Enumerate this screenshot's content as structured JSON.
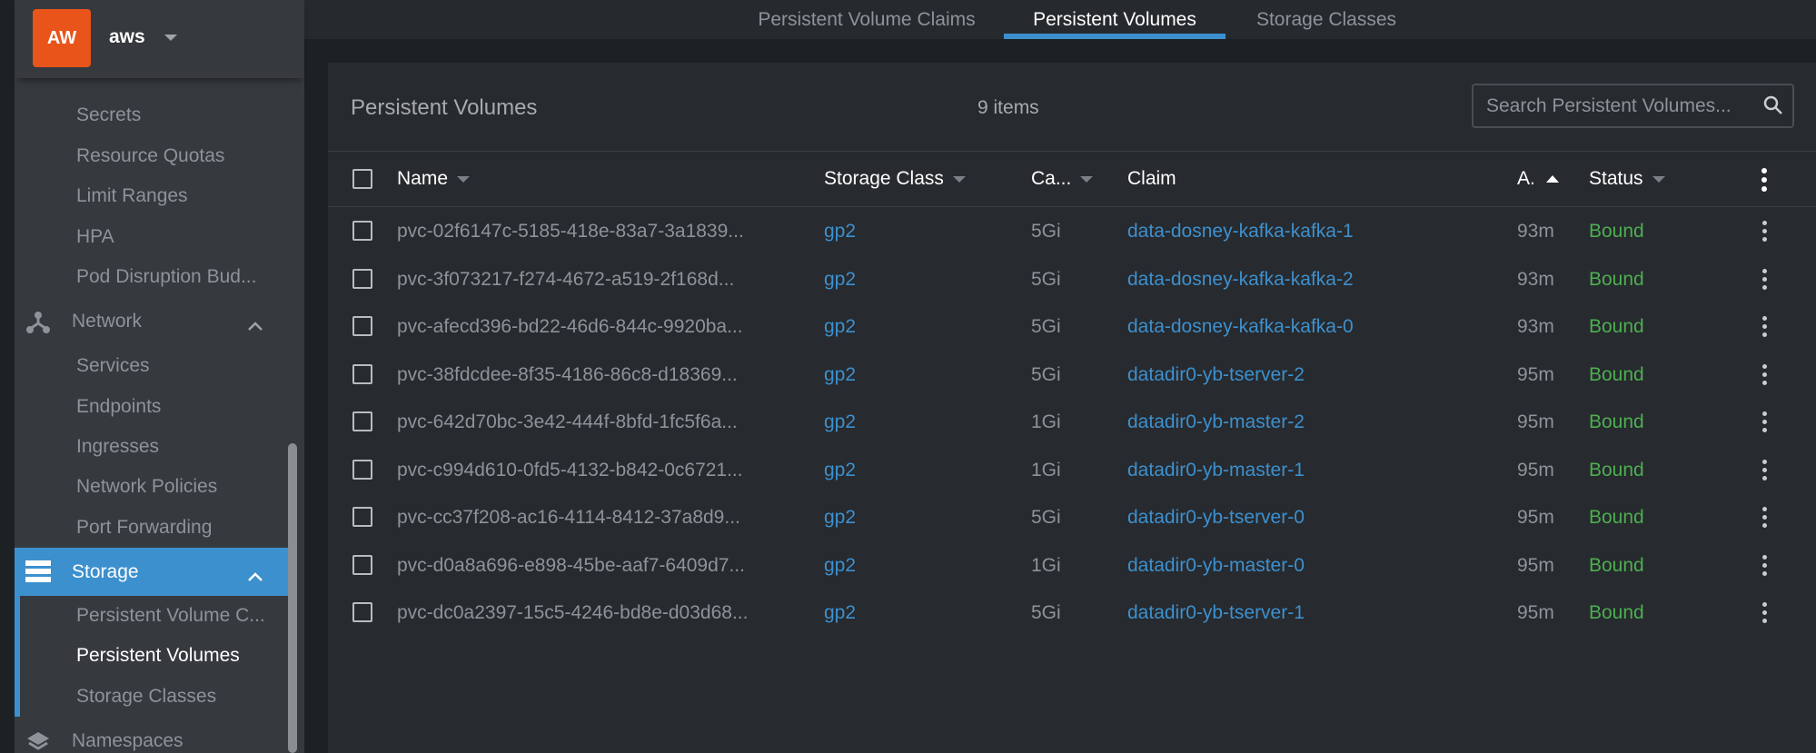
{
  "cluster": {
    "avatar": "AW",
    "name": "aws"
  },
  "sidebar": {
    "config_items": [
      "Secrets",
      "Resource Quotas",
      "Limit Ranges",
      "HPA",
      "Pod Disruption Bud..."
    ],
    "network": {
      "label": "Network",
      "icon": "network-icon",
      "items": [
        "Services",
        "Endpoints",
        "Ingresses",
        "Network Policies",
        "Port Forwarding"
      ]
    },
    "storage": {
      "label": "Storage",
      "icon": "storage-icon",
      "items": [
        "Persistent Volume C...",
        "Persistent Volumes",
        "Storage Classes"
      ],
      "active_item": "Persistent Volumes"
    },
    "namespaces": {
      "label": "Namespaces",
      "icon": "layers-icon"
    }
  },
  "tabs": [
    "Persistent Volume Claims",
    "Persistent Volumes",
    "Storage Classes"
  ],
  "active_tab": "Persistent Volumes",
  "panel": {
    "title": "Persistent Volumes",
    "count": "9 items",
    "search_placeholder": "Search Persistent Volumes..."
  },
  "columns": {
    "name": "Name",
    "storage_class": "Storage Class",
    "capacity": "Ca...",
    "claim": "Claim",
    "age": "A.",
    "status": "Status"
  },
  "rows": [
    {
      "name": "pvc-02f6147c-5185-418e-83a7-3a1839...",
      "storage_class": "gp2",
      "capacity": "5Gi",
      "claim": "data-dosney-kafka-kafka-1",
      "age": "93m",
      "status": "Bound"
    },
    {
      "name": "pvc-3f073217-f274-4672-a519-2f168d...",
      "storage_class": "gp2",
      "capacity": "5Gi",
      "claim": "data-dosney-kafka-kafka-2",
      "age": "93m",
      "status": "Bound"
    },
    {
      "name": "pvc-afecd396-bd22-46d6-844c-9920ba...",
      "storage_class": "gp2",
      "capacity": "5Gi",
      "claim": "data-dosney-kafka-kafka-0",
      "age": "93m",
      "status": "Bound"
    },
    {
      "name": "pvc-38fdcdee-8f35-4186-86c8-d18369...",
      "storage_class": "gp2",
      "capacity": "5Gi",
      "claim": "datadir0-yb-tserver-2",
      "age": "95m",
      "status": "Bound"
    },
    {
      "name": "pvc-642d70bc-3e42-444f-8bfd-1fc5f6a...",
      "storage_class": "gp2",
      "capacity": "1Gi",
      "claim": "datadir0-yb-master-2",
      "age": "95m",
      "status": "Bound"
    },
    {
      "name": "pvc-c994d610-0fd5-4132-b842-0c6721...",
      "storage_class": "gp2",
      "capacity": "1Gi",
      "claim": "datadir0-yb-master-1",
      "age": "95m",
      "status": "Bound"
    },
    {
      "name": "pvc-cc37f208-ac16-4114-8412-37a8d9...",
      "storage_class": "gp2",
      "capacity": "5Gi",
      "claim": "datadir0-yb-tserver-0",
      "age": "95m",
      "status": "Bound"
    },
    {
      "name": "pvc-d0a8a696-e898-45be-aaf7-6409d7...",
      "storage_class": "gp2",
      "capacity": "1Gi",
      "claim": "datadir0-yb-master-0",
      "age": "95m",
      "status": "Bound"
    },
    {
      "name": "pvc-dc0a2397-15c5-4246-bd8e-d03d68...",
      "storage_class": "gp2",
      "capacity": "5Gi",
      "claim": "datadir0-yb-tserver-1",
      "age": "95m",
      "status": "Bound"
    }
  ],
  "colors": {
    "accent": "#3d90ce",
    "status_bound": "#4caf50",
    "avatar": "#e8541a"
  }
}
